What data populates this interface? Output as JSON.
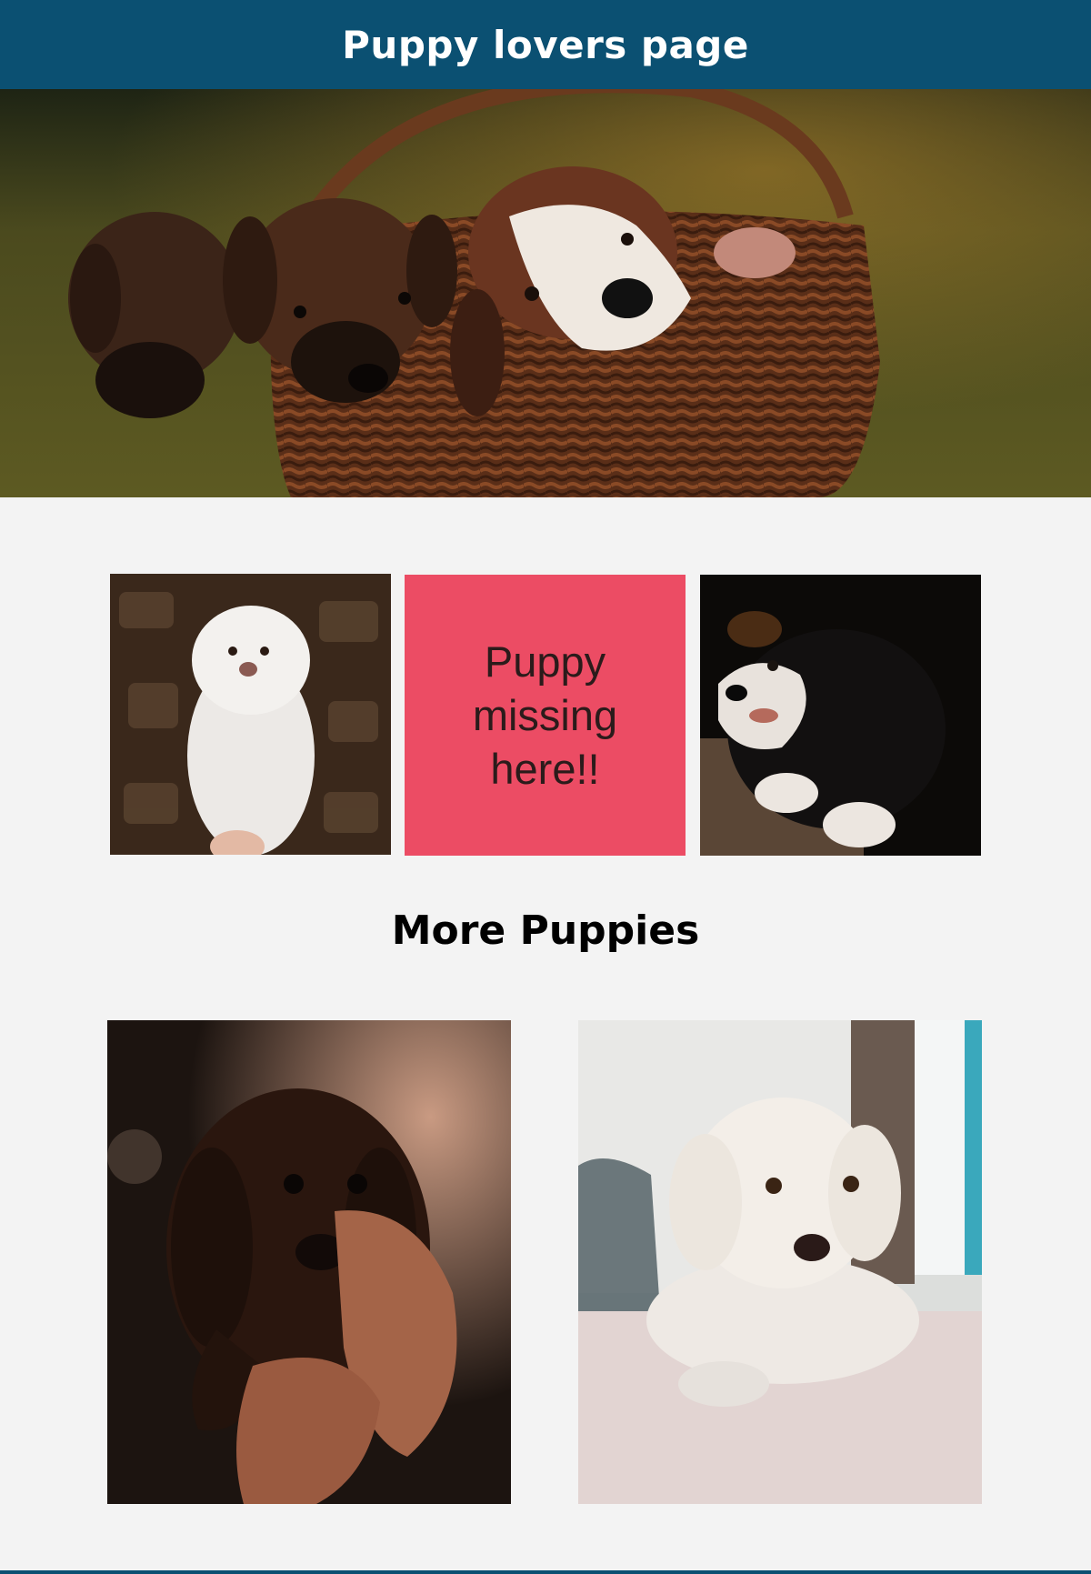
{
  "header": {
    "title": "Puppy lovers page"
  },
  "gallery": {
    "missing_text": "Puppy missing here!!"
  },
  "more_section": {
    "title": "More Puppies"
  },
  "colors": {
    "header_bg": "#0b5072",
    "page_bg": "#f3f3f3",
    "missing_tile_bg": "#ec4c64"
  }
}
